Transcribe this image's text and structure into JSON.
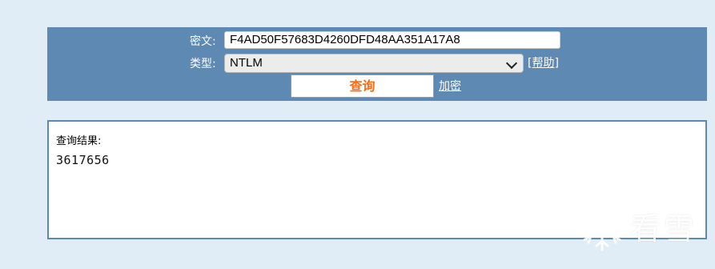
{
  "form": {
    "cipher_label": "密文:",
    "cipher_value": "F4AD50F57683D4260DFD48AA351A17A8",
    "type_label": "类型:",
    "type_selected": "NTLM",
    "help_link": "[帮助]",
    "query_button": "查询",
    "encrypt_link": "加密"
  },
  "result": {
    "title": "查询结果:",
    "value": "3617656"
  },
  "watermark": {
    "text": "看雪",
    "icon": "snowflake-icon"
  },
  "colors": {
    "page_background": "#e1edf6",
    "panel_background": "#5d89b3",
    "button_text": "#ff6a13"
  }
}
